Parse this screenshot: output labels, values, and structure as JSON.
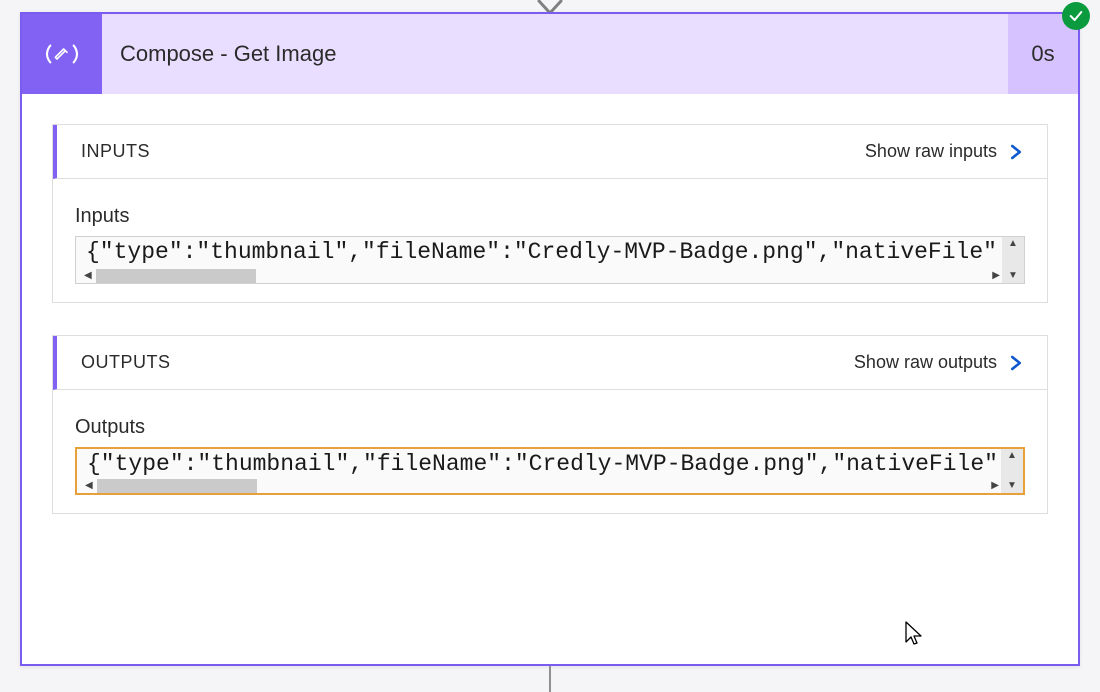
{
  "flow": {
    "title": "Compose - Get Image",
    "duration": "0s",
    "status": "success"
  },
  "sections": {
    "inputs": {
      "headerLabel": "INPUTS",
      "rawLinkLabel": "Show raw inputs",
      "fieldLabel": "Inputs",
      "value": "{\"type\":\"thumbnail\",\"fileName\":\"Credly-MVP-Badge.png\",\"nativeFile\":"
    },
    "outputs": {
      "headerLabel": "OUTPUTS",
      "rawLinkLabel": "Show raw outputs",
      "fieldLabel": "Outputs",
      "value": "{\"type\":\"thumbnail\",\"fileName\":\"Credly-MVP-Badge.png\",\"nativeFile\":"
    }
  }
}
